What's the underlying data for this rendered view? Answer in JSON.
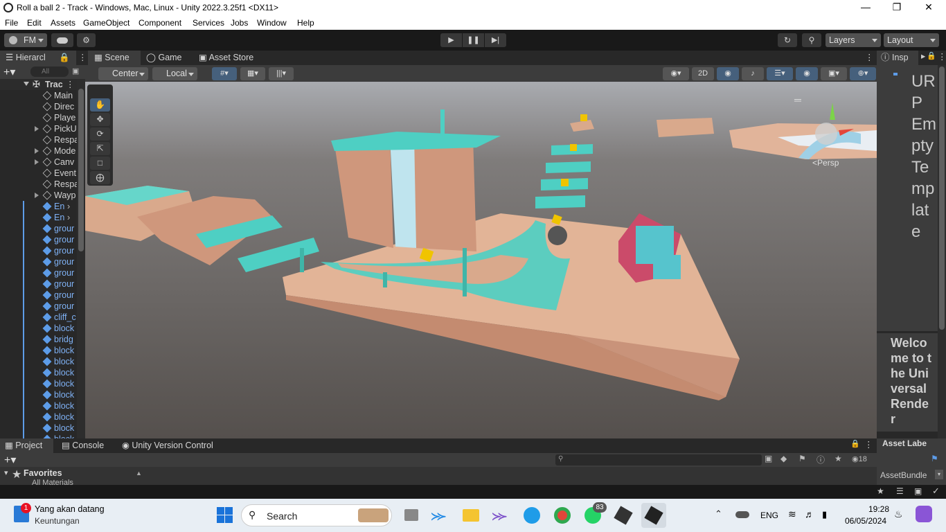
{
  "window": {
    "title": "Roll a ball 2 - Track - Windows, Mac, Linux - Unity 2022.3.25f1 <DX11>"
  },
  "menu": [
    "File",
    "Edit",
    "Assets",
    "GameObject",
    "Component",
    "Services",
    "Jobs",
    "Window",
    "Help"
  ],
  "toolbar": {
    "account": "FM",
    "layers": "Layers",
    "layout": "Layout"
  },
  "hierarchy": {
    "tab": "Hierarcl",
    "search_placeholder": "All",
    "scene": "Trac",
    "items": [
      {
        "label": "Main",
        "prefab": false,
        "expand": false
      },
      {
        "label": "Direc",
        "prefab": false,
        "expand": false
      },
      {
        "label": "Playe",
        "prefab": false,
        "expand": false
      },
      {
        "label": "PickU",
        "prefab": false,
        "expand": true
      },
      {
        "label": "Respa",
        "prefab": false,
        "expand": false
      },
      {
        "label": "Mode",
        "prefab": false,
        "expand": true
      },
      {
        "label": "Canv",
        "prefab": false,
        "expand": true
      },
      {
        "label": "Event",
        "prefab": false,
        "expand": false
      },
      {
        "label": "Respa",
        "prefab": false,
        "expand": false
      },
      {
        "label": "Wayp",
        "prefab": false,
        "expand": true
      },
      {
        "label": "En",
        "prefab": true,
        "expand": false
      },
      {
        "label": "En",
        "prefab": true,
        "expand": false
      },
      {
        "label": "grour",
        "prefab": true,
        "expand": false
      },
      {
        "label": "grour",
        "prefab": true,
        "expand": false
      },
      {
        "label": "grour",
        "prefab": true,
        "expand": false
      },
      {
        "label": "grour",
        "prefab": true,
        "expand": false
      },
      {
        "label": "grour",
        "prefab": true,
        "expand": false
      },
      {
        "label": "grour",
        "prefab": true,
        "expand": false
      },
      {
        "label": "grour",
        "prefab": true,
        "expand": false
      },
      {
        "label": "grour",
        "prefab": true,
        "expand": false
      },
      {
        "label": "cliff_c",
        "prefab": true,
        "expand": false
      },
      {
        "label": "block",
        "prefab": true,
        "expand": false
      },
      {
        "label": "bridg",
        "prefab": true,
        "expand": false
      },
      {
        "label": "block",
        "prefab": true,
        "expand": false
      },
      {
        "label": "block",
        "prefab": true,
        "expand": false
      },
      {
        "label": "block",
        "prefab": true,
        "expand": false
      },
      {
        "label": "block",
        "prefab": true,
        "expand": false
      },
      {
        "label": "block",
        "prefab": true,
        "expand": false
      },
      {
        "label": "block",
        "prefab": true,
        "expand": false
      },
      {
        "label": "block",
        "prefab": true,
        "expand": false
      },
      {
        "label": "block",
        "prefab": true,
        "expand": false
      },
      {
        "label": "block",
        "prefab": true,
        "expand": false
      }
    ]
  },
  "scene": {
    "tabs": [
      "Scene",
      "Game",
      "Asset Store"
    ],
    "pivot": "Center",
    "space": "Local",
    "mode2d": "2D",
    "persp": "Persp"
  },
  "inspector": {
    "tab": "Insp",
    "readme_title": "URP Empty Template",
    "readme_text": "Welcome to the Universal Render"
  },
  "bottom": {
    "tabs": [
      "Project",
      "Console",
      "Unity Version Control"
    ],
    "favorites": "Favorites",
    "sub": "All Materials",
    "hidden_count": "18",
    "asset_labels": "Asset Labe",
    "asset_bundle": "AssetBundle"
  },
  "taskbar": {
    "notif_title": "Yang akan datang",
    "notif_sub": "Keuntungan",
    "notif_badge": "1",
    "search": "Search",
    "whatsapp_badge": "83",
    "lang": "ENG",
    "time": "19:28",
    "date": "06/05/2024"
  }
}
